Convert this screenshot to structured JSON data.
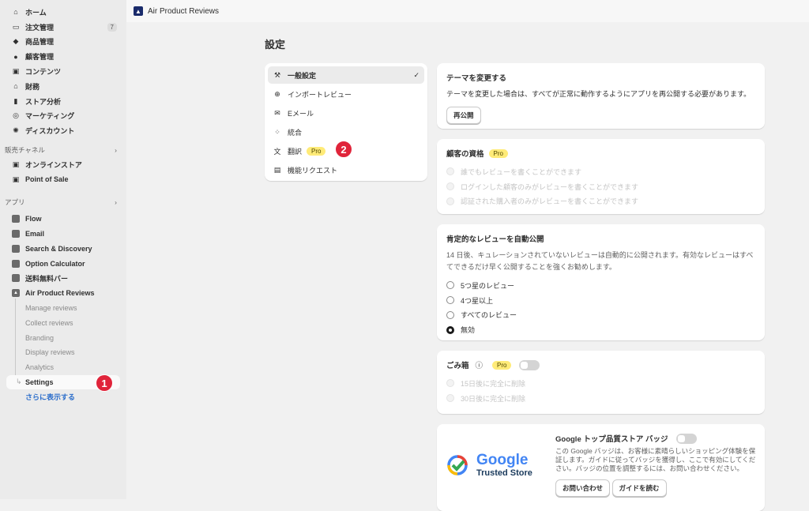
{
  "sidebar": {
    "main": [
      {
        "label": "ホーム",
        "icon": "home-icon"
      },
      {
        "label": "注文管理",
        "icon": "inbox-icon",
        "badge": "7"
      },
      {
        "label": "商品管理",
        "icon": "tag-icon"
      },
      {
        "label": "顧客管理",
        "icon": "person-icon"
      },
      {
        "label": "コンテンツ",
        "icon": "content-icon"
      },
      {
        "label": "財務",
        "icon": "bank-icon"
      },
      {
        "label": "ストア分析",
        "icon": "chart-icon"
      },
      {
        "label": "マーケティング",
        "icon": "target-icon"
      },
      {
        "label": "ディスカウント",
        "icon": "discount-icon"
      }
    ],
    "sales_channels_label": "販売チャネル",
    "channels": [
      {
        "label": "オンラインストア"
      },
      {
        "label": "Point of Sale"
      }
    ],
    "apps_label": "アプリ",
    "apps": [
      {
        "label": "Flow"
      },
      {
        "label": "Email"
      },
      {
        "label": "Search & Discovery"
      },
      {
        "label": "Option Calculator"
      },
      {
        "label": "送料無料バー"
      },
      {
        "label": "Air Product Reviews"
      }
    ],
    "subitems": [
      "Manage reviews",
      "Collect reviews",
      "Branding",
      "Display reviews",
      "Analytics",
      "Settings"
    ],
    "more": "さらに表示する"
  },
  "annotations": [
    "1",
    "2"
  ],
  "topbar": {
    "app_name": "Air Product Reviews"
  },
  "page": {
    "title": "設定"
  },
  "settings_nav": [
    {
      "label": "一般設定"
    },
    {
      "label": "インポートレビュー"
    },
    {
      "label": "Eメール"
    },
    {
      "label": "統合"
    },
    {
      "label": "翻訳",
      "badge": "Pro"
    },
    {
      "label": "機能リクエスト"
    }
  ],
  "theme": {
    "title": "テーマを変更する",
    "desc": "テーマを変更した場合は、すべてが正常に動作するようにアプリを再公開する必要があります。",
    "button": "再公開"
  },
  "eligibility": {
    "title": "顧客の資格",
    "badge": "Pro",
    "options": [
      "誰でもレビューを書くことができます",
      "ログインした顧客のみがレビューを書くことができます",
      "認証された購入者のみがレビューを書くことができます"
    ]
  },
  "autopublish": {
    "title": "肯定的なレビューを自動公開",
    "desc": "14 日後、キュレーションされていないレビューは自動的に公開されます。有効なレビューはすべてできるだけ早く公開することを強くお勧めします。",
    "options": [
      "5つ星のレビュー",
      "4つ星以上",
      "すべてのレビュー",
      "無効"
    ],
    "selected": "無効"
  },
  "trash": {
    "title": "ごみ箱",
    "badge": "Pro",
    "enabled": false,
    "options": [
      "15日後に完全に削除",
      "30日後に完全に削除"
    ]
  },
  "google": {
    "title": "Google トップ品質ストア バッジ",
    "enabled": false,
    "logo_word": "Google",
    "logo_sub": "Trusted Store",
    "desc": "この Google バッジは、お客様に素晴らしいショッピング体験を保証します。ガイドに従ってバッジを獲得し、ここで有効にしてください。バッジの位置を調整するには、お問い合わせください。",
    "contact": "お問い合わせ",
    "guide": "ガイドを読む"
  }
}
